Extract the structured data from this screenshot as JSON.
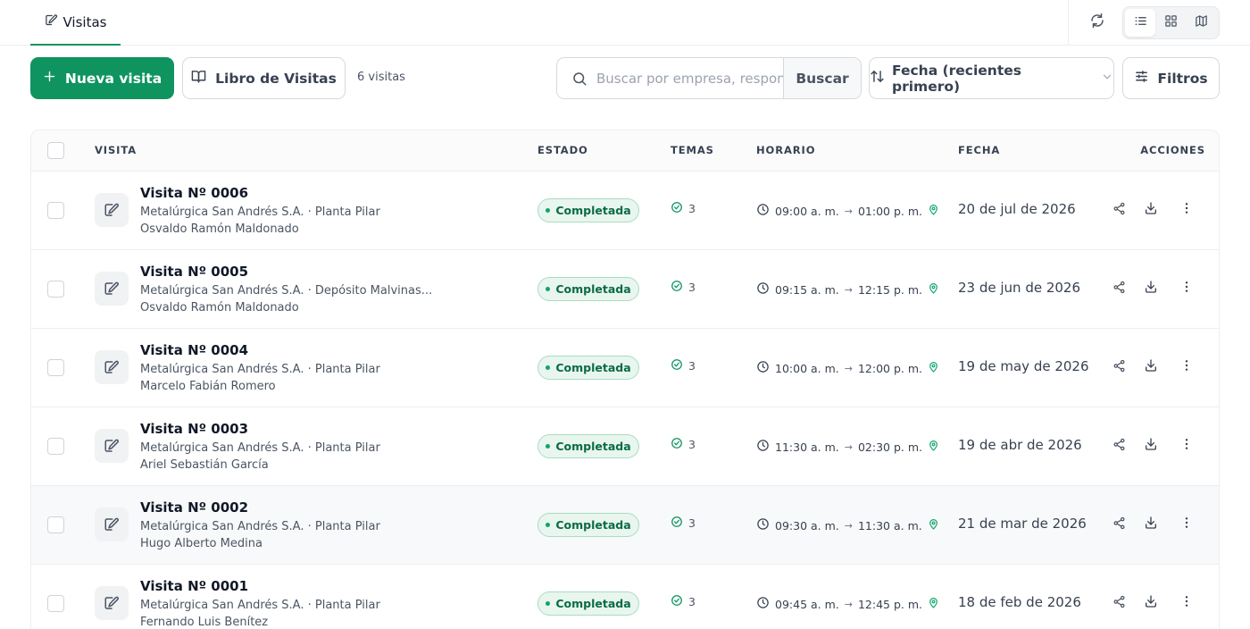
{
  "header": {
    "tab_label": "Visitas",
    "icons": {
      "tab": "edit-note-icon",
      "refresh": "refresh-icon",
      "views": [
        "list-view-icon",
        "grid-view-icon",
        "map-view-icon"
      ]
    },
    "active_view": "list"
  },
  "toolbar": {
    "new_visit_label": "Nueva visita",
    "book_label": "Libro de Visitas",
    "count_text": "6 visitas",
    "search_placeholder": "Buscar por empresa, responsable...",
    "search_value": "",
    "search_button": "Buscar",
    "sort_label": "Fecha (recientes primero)",
    "filters_label": "Filtros"
  },
  "table": {
    "columns": {
      "visita": "VISITA",
      "estado": "ESTADO",
      "temas": "TEMAS",
      "horario": "HORARIO",
      "fecha": "FECHA",
      "acciones": "ACCIONES"
    },
    "rows": [
      {
        "title": "Visita Nº 0006",
        "location": "Metalúrgica San Andrés S.A. · Planta Pilar",
        "person": "Osvaldo Ramón Maldonado",
        "status": "Completada",
        "temas": "3",
        "start": "09:00 a. m.",
        "arrow": "→",
        "end": "01:00 p. m.",
        "date": "20 de jul de 2026"
      },
      {
        "title": "Visita Nº 0005",
        "location": "Metalúrgica San Andrés S.A. · Depósito Malvinas...",
        "person": "Osvaldo Ramón Maldonado",
        "status": "Completada",
        "temas": "3",
        "start": "09:15 a. m.",
        "arrow": "→",
        "end": "12:15 p. m.",
        "date": "23 de jun de 2026"
      },
      {
        "title": "Visita Nº 0004",
        "location": "Metalúrgica San Andrés S.A. · Planta Pilar",
        "person": "Marcelo Fabián Romero",
        "status": "Completada",
        "temas": "3",
        "start": "10:00 a. m.",
        "arrow": "→",
        "end": "12:00 p. m.",
        "date": "19 de may de 2026"
      },
      {
        "title": "Visita Nº 0003",
        "location": "Metalúrgica San Andrés S.A. · Planta Pilar",
        "person": "Ariel Sebastián García",
        "status": "Completada",
        "temas": "3",
        "start": "11:30 a. m.",
        "arrow": "→",
        "end": "02:30 p. m.",
        "date": "19 de abr de 2026"
      },
      {
        "title": "Visita Nº 0002",
        "location": "Metalúrgica San Andrés S.A. · Planta Pilar",
        "person": "Hugo Alberto Medina",
        "status": "Completada",
        "temas": "3",
        "start": "09:30 a. m.",
        "arrow": "→",
        "end": "11:30 a. m.",
        "date": "21 de mar de 2026"
      },
      {
        "title": "Visita Nº 0001",
        "location": "Metalúrgica San Andrés S.A. · Planta Pilar",
        "person": "Fernando Luis Benítez",
        "status": "Completada",
        "temas": "3",
        "start": "09:45 a. m.",
        "arrow": "→",
        "end": "12:45 p. m.",
        "date": "18 de feb de 2026"
      }
    ]
  },
  "colors": {
    "accent": "#0f9460",
    "status_bg": "#e8f6ef",
    "status_text": "#0b6b45"
  }
}
